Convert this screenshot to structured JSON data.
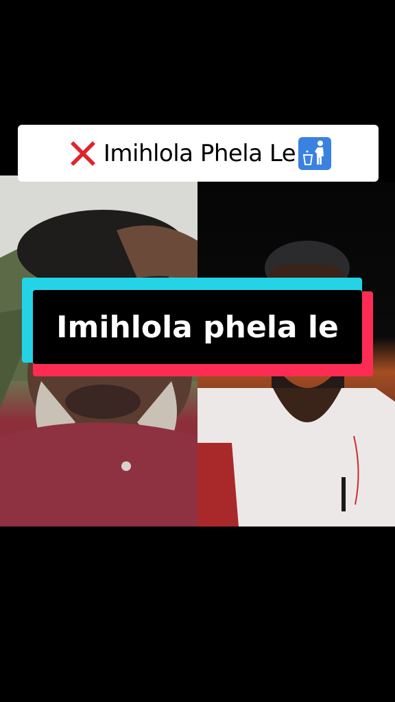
{
  "top_caption": {
    "leading_emoji": "cross-mark-icon",
    "text": "Imihlola Phela Le",
    "trailing_emoji": "litter-in-bin-icon"
  },
  "center_caption": {
    "text": "Imihlola phela le"
  },
  "colors": {
    "background": "#000000",
    "caption_accent_cyan": "#24d4e6",
    "caption_accent_red": "#fe2c55",
    "cross_mark": "#e0242b",
    "bin_sign": "#3b82e0"
  }
}
